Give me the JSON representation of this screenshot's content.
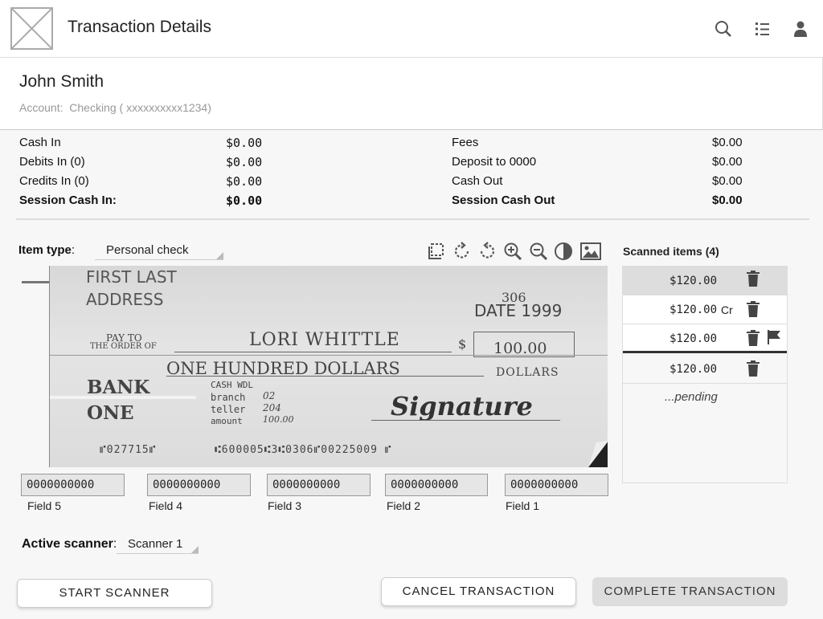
{
  "header": {
    "title": "Transaction Details",
    "icons": [
      "search-icon",
      "list-icon",
      "user-icon"
    ]
  },
  "customer": {
    "name": "John Smith",
    "account_label": "Account:",
    "account_value": "Checking ( xxxxxxxxxx1234)"
  },
  "summary_left": [
    {
      "label": "Cash In",
      "value": "$0.00"
    },
    {
      "label": "Debits In (0)",
      "value": "$0.00"
    },
    {
      "label": "Credits In (0)",
      "value": "$0.00"
    },
    {
      "label": "Session Cash In:",
      "value": "$0.00"
    }
  ],
  "summary_right": [
    {
      "label": "Fees",
      "value": "$0.00"
    },
    {
      "label": "Deposit to 0000",
      "value": "$0.00"
    },
    {
      "label": "Cash Out",
      "value": "$0.00"
    },
    {
      "label": "Session Cash Out",
      "value": "$0.00"
    }
  ],
  "item_type": {
    "label": "Item type",
    "value": "Personal check"
  },
  "image_tools": [
    "crop-icon",
    "rotate-clockwise-icon",
    "rotate-counterclockwise-icon",
    "zoom-in-icon",
    "zoom-out-icon",
    "contrast-icon",
    "image-icon"
  ],
  "check": {
    "name_line": "FIRST LAST",
    "address_line": "ADDRESS",
    "check_no": "306",
    "date": "DATE 1999",
    "pay_to": "PAY TO",
    "order_of": "THE ORDER OF",
    "payee": "LORI WHITTLE",
    "dollar_sign": "$",
    "amount": "100.00",
    "written_amount": "ONE HUNDRED DOLLARS",
    "dollars": "DOLLARS",
    "bank_line1": "BANK",
    "bank_line2": "ONE",
    "memo1": "CASH WDL",
    "memo2_label": "branch",
    "memo2_value": "02",
    "memo3_label": "teller",
    "memo3_value": "204",
    "memo4_label": "amount",
    "memo4_value": "100.00",
    "signature": "Signature",
    "micr_left": "⑈027715⑈",
    "micr_right": "⑆600005⑆3⑆0306⑈00225009 ⑈"
  },
  "fields": [
    {
      "label": "Field 5",
      "value": "0000000000"
    },
    {
      "label": "Field 4",
      "value": "0000000000"
    },
    {
      "label": "Field 3",
      "value": "0000000000"
    },
    {
      "label": "Field 2",
      "value": "0000000000"
    },
    {
      "label": "Field 1",
      "value": "0000000000"
    }
  ],
  "scanner": {
    "label": "Active scanner",
    "value": "Scanner 1"
  },
  "scanned": {
    "title": "Scanned items (4)",
    "items": [
      {
        "amount": "$120.00",
        "tag": "",
        "flag": false,
        "selected": true
      },
      {
        "amount": "$120.00",
        "tag": "Cr",
        "flag": false,
        "selected": false
      },
      {
        "amount": "$120.00",
        "tag": "",
        "flag": true,
        "selected": false
      },
      {
        "amount": "$120.00",
        "tag": "",
        "flag": false,
        "selected": false
      }
    ],
    "pending": "...pending"
  },
  "buttons": {
    "start": "START SCANNER",
    "cancel": "CANCEL TRANSACTION",
    "complete": "COMPLETE TRANSACTION"
  },
  "colors": {
    "selected_row": "#dddddd",
    "accent_line": "#333333"
  }
}
